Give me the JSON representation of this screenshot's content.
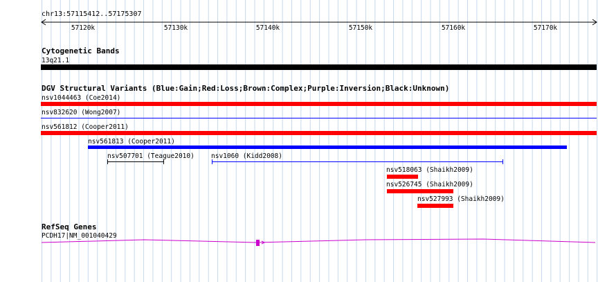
{
  "ruler": {
    "position": "chr13:57115412..57175307",
    "ticks": [
      "57120k",
      "57130k",
      "57140k",
      "57150k",
      "57160k",
      "57170k"
    ]
  },
  "cytobands": {
    "title": "Cytogenetic Bands",
    "band_label": "13q21.1"
  },
  "dgv": {
    "title": "DGV Structural Variants (Blue:Gain;Red:Loss;Brown:Complex;Purple:Inversion;Black:Unknown)",
    "features": [
      {
        "label": "nsv1044463 (Coe2014)",
        "color": "#ff0000"
      },
      {
        "label": "nsv832620 (Wong2007)",
        "color": "#0000ff"
      },
      {
        "label": "nsv561812 (Cooper2011)",
        "color": "#ff0000"
      },
      {
        "label": "nsv561813 (Cooper2011)",
        "color": "#0000ff"
      },
      {
        "label": "nsv507701 (Teague2010)",
        "color": "#000000"
      },
      {
        "label": "nsv1060 (Kidd2008)",
        "color": "#0000ff"
      },
      {
        "label": "nsv518063 (Shaikh2009)",
        "color": "#ff0000"
      },
      {
        "label": "nsv526745 (Shaikh2009)",
        "color": "#ff0000"
      },
      {
        "label": "nsv527993 (Shaikh2009)",
        "color": "#ff0000"
      }
    ]
  },
  "refseq": {
    "title": "RefSeq Genes",
    "gene_label": "PCDH17|NM_001040429",
    "color": "#cc00cc"
  }
}
